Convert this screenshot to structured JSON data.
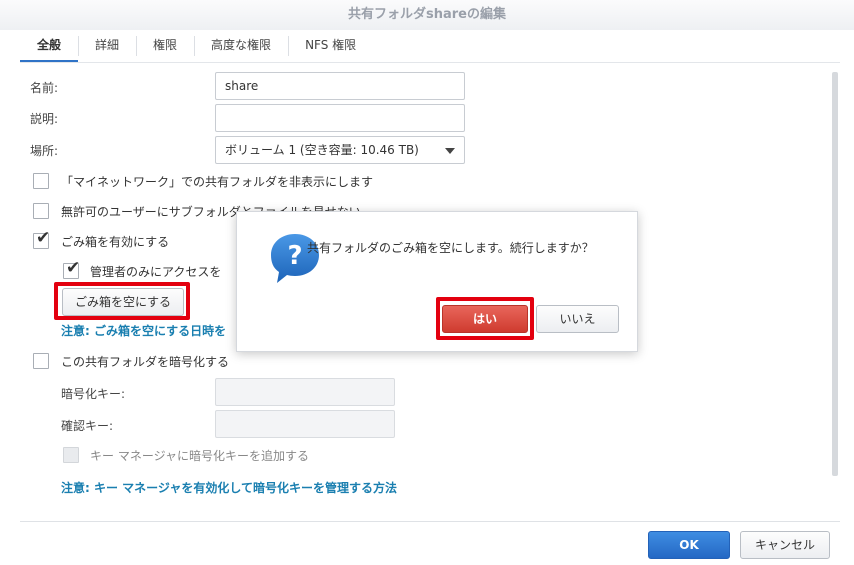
{
  "window": {
    "title": "共有フォルダshareの編集"
  },
  "tabs": [
    {
      "label": "全般",
      "active": true
    },
    {
      "label": "詳細"
    },
    {
      "label": "権限"
    },
    {
      "label": "高度な権限"
    },
    {
      "label": "NFS 権限"
    }
  ],
  "form": {
    "name_label": "名前:",
    "name_value": "share",
    "description_label": "説明:",
    "description_value": "",
    "location_label": "場所:",
    "location_value": "ボリューム 1 (空き容量: 10.46 TB)",
    "hide_network_label": "「マイネットワーク」での共有フォルダを非表示にします",
    "hide_network_checked": false,
    "hide_unauthorized_label": "無許可のユーザーにサブフォルダとファイルを見せない",
    "hide_unauthorized_checked": false,
    "recycle_bin_label": "ごみ箱を有効にする",
    "recycle_bin_checked": true,
    "admin_only_label": "管理者のみにアクセスを",
    "admin_only_checked": true,
    "empty_recycle_button": "ごみ箱を空にする",
    "empty_note": "注意: ごみ箱を空にする日時を",
    "encrypt_label": "この共有フォルダを暗号化する",
    "encrypt_checked": false,
    "enc_key_label": "暗号化キー:",
    "confirm_key_label": "確認キー:",
    "key_manager_label": "キー マネージャに暗号化キーを追加する",
    "key_manager_note": "注意: キー マネージャを有効化して暗号化キーを管理する方法"
  },
  "footer": {
    "ok_label": "OK",
    "cancel_label": "キャンセル"
  },
  "dialog": {
    "message": "共有フォルダのごみ箱を空にします。続行しますか？",
    "yes_label": "はい",
    "no_label": "いいえ",
    "icon_glyph": "?"
  },
  "colors": {
    "accent_blue": "#2f73c7",
    "note_blue": "#1a7fb0",
    "highlight_red": "#e3000f",
    "yes_red": "#d9473b"
  }
}
